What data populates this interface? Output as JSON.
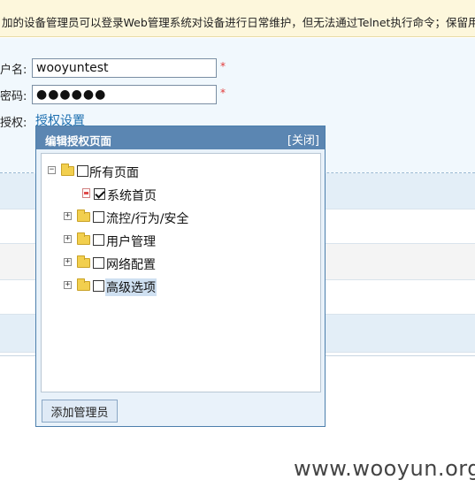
{
  "notice": "加的设备管理员可以登录Web管理系统对设备进行日常维护，但无法通过Telnet执行命令；保留用户m",
  "form": {
    "username_label": "户名:",
    "username_value": "wooyuntest",
    "password_label": "密码:",
    "password_value": "●●●●●●",
    "required_mark": "*",
    "auth_label": "授权:",
    "auth_link": "授权设置"
  },
  "dialog": {
    "title": "编辑授权页面",
    "close": "[关闭]",
    "tree": [
      {
        "label": "所有页面",
        "checked": false
      },
      {
        "label": "系统首页",
        "checked": true
      },
      {
        "label": "流控/行为/安全",
        "checked": false
      },
      {
        "label": "用户管理",
        "checked": false
      },
      {
        "label": "网络配置",
        "checked": false
      },
      {
        "label": "高级选项",
        "checked": false,
        "highlighted": true
      }
    ],
    "add_button": "添加管理员"
  },
  "watermark": "www.wooyun.org",
  "colors": {
    "notice_bg": "#fdf7dc",
    "form_bg": "#f1f8fd",
    "dialog_title_bg": "#5b86b2",
    "link": "#1d6fb0",
    "required": "#e23a3a"
  },
  "icons": [
    "collapse-icon",
    "expand-icon",
    "folder-icon",
    "page-icon",
    "checkbox-icon"
  ]
}
